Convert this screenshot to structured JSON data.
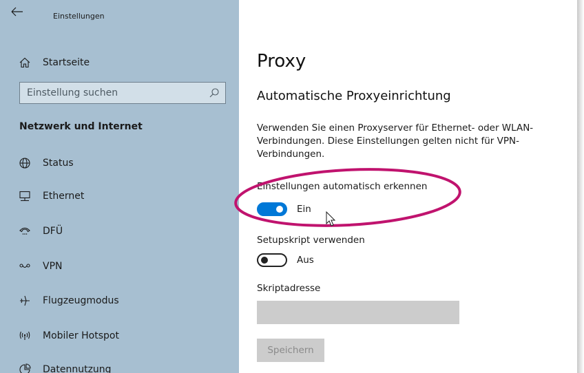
{
  "window": {
    "title": "Einstellungen"
  },
  "sidebar": {
    "home_label": "Startseite",
    "search_placeholder": "Einstellung suchen",
    "section_heading": "Netzwerk und Internet",
    "items": [
      {
        "label": "Status",
        "icon": "globe-icon"
      },
      {
        "label": "Ethernet",
        "icon": "ethernet-icon"
      },
      {
        "label": "DFÜ",
        "icon": "dialup-icon"
      },
      {
        "label": "VPN",
        "icon": "vpn-icon"
      },
      {
        "label": "Flugzeugmodus",
        "icon": "airplane-icon"
      },
      {
        "label": "Mobiler Hotspot",
        "icon": "hotspot-icon"
      },
      {
        "label": "Datennutzung",
        "icon": "data-usage-icon"
      }
    ]
  },
  "main": {
    "page_title": "Proxy",
    "section_title": "Automatische Proxyeinrichtung",
    "description": "Verwenden Sie einen Proxyserver für Ethernet- oder WLAN-Verbindungen. Diese Einstellungen gelten nicht für VPN-Verbindungen.",
    "auto_detect": {
      "label": "Einstellungen automatisch erkennen",
      "state": "Ein",
      "on": true
    },
    "setup_script": {
      "label": "Setupskript verwenden",
      "state": "Aus",
      "on": false
    },
    "script_address": {
      "label": "Skriptadresse",
      "value": ""
    },
    "save_label": "Speichern"
  },
  "colors": {
    "sidebar_bg": "#a7bfd1",
    "accent": "#0078d7",
    "highlight": "#c0136e"
  }
}
